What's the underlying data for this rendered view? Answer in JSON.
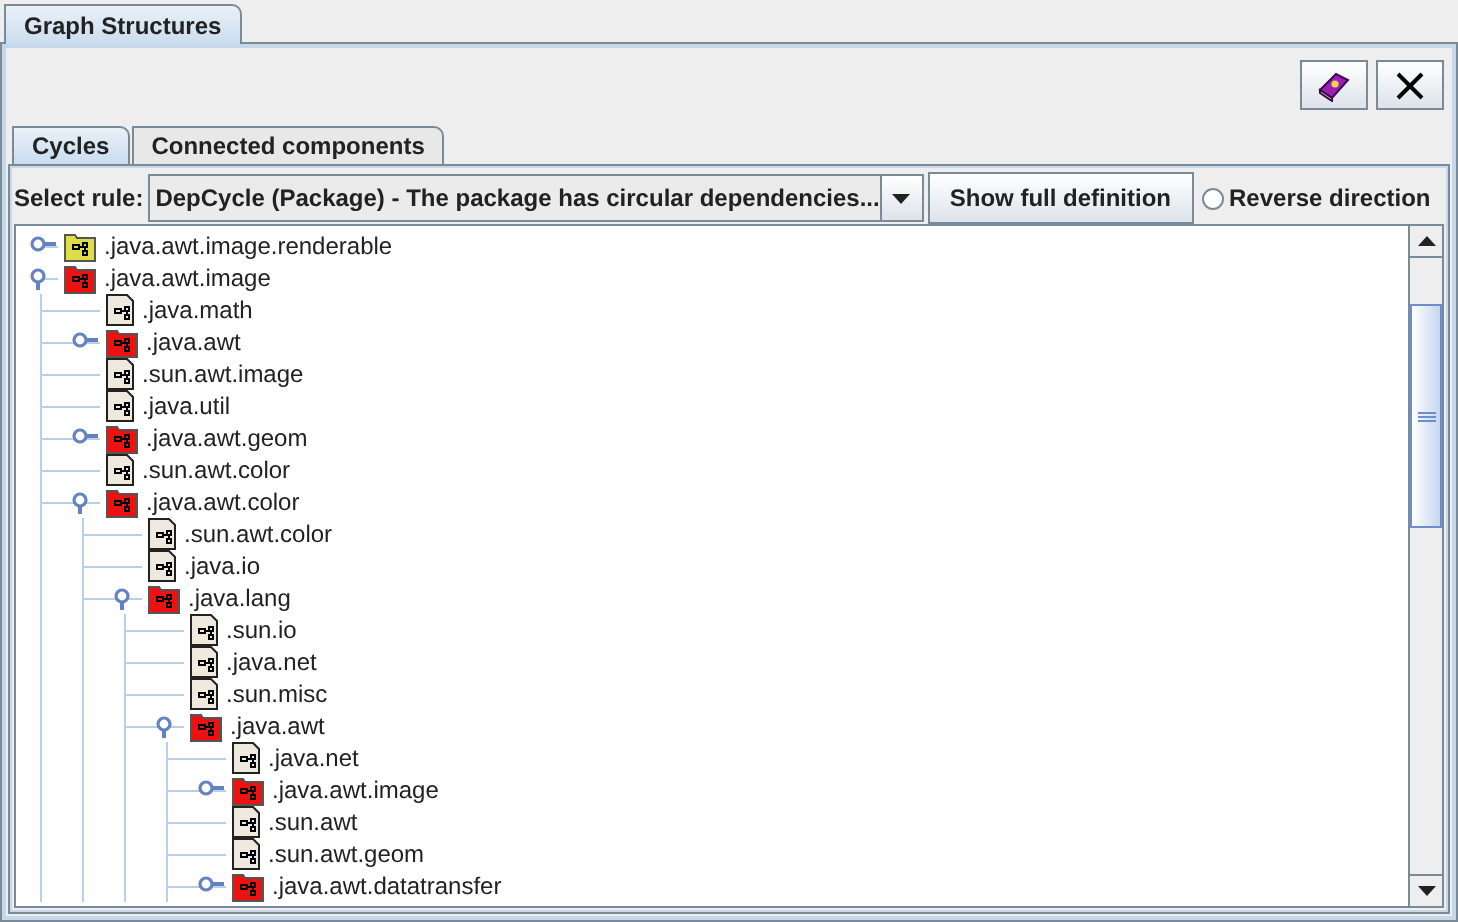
{
  "window_tab": {
    "label": "Graph Structures",
    "selected": true
  },
  "tabs": [
    {
      "label": "Cycles",
      "selected": true
    },
    {
      "label": "Connected components",
      "selected": false
    }
  ],
  "rule": {
    "label": "Select rule:",
    "value": "DepCycle (Package) - The package has circular dependencies...",
    "definition_button": "Show full definition",
    "reverse": {
      "label": "Reverse direction",
      "checked": false
    }
  },
  "tree": [
    {
      "label": ".java.awt.image.renderable",
      "kind": "yellow-folder",
      "expanded": false
    },
    {
      "label": ".java.awt.image",
      "kind": "red-folder",
      "expanded": true,
      "children": [
        {
          "label": ".java.math",
          "kind": "page"
        },
        {
          "label": ".java.awt",
          "kind": "red-folder",
          "expanded": false
        },
        {
          "label": ".sun.awt.image",
          "kind": "page"
        },
        {
          "label": ".java.util",
          "kind": "page"
        },
        {
          "label": ".java.awt.geom",
          "kind": "red-folder",
          "expanded": false
        },
        {
          "label": ".sun.awt.color",
          "kind": "page"
        },
        {
          "label": ".java.awt.color",
          "kind": "red-folder",
          "expanded": true,
          "children": [
            {
              "label": ".sun.awt.color",
              "kind": "page"
            },
            {
              "label": ".java.io",
              "kind": "page"
            },
            {
              "label": ".java.lang",
              "kind": "red-folder",
              "expanded": true,
              "children": [
                {
                  "label": ".sun.io",
                  "kind": "page"
                },
                {
                  "label": ".java.net",
                  "kind": "page"
                },
                {
                  "label": ".sun.misc",
                  "kind": "page"
                },
                {
                  "label": ".java.awt",
                  "kind": "red-folder",
                  "expanded": true,
                  "children": [
                    {
                      "label": ".java.net",
                      "kind": "page"
                    },
                    {
                      "label": ".java.awt.image",
                      "kind": "red-folder",
                      "expanded": false
                    },
                    {
                      "label": ".sun.awt",
                      "kind": "page"
                    },
                    {
                      "label": ".sun.awt.geom",
                      "kind": "page"
                    },
                    {
                      "label": ".java.awt.datatransfer",
                      "kind": "red-folder",
                      "expanded": false
                    }
                  ]
                }
              ]
            }
          ]
        }
      ]
    }
  ]
}
